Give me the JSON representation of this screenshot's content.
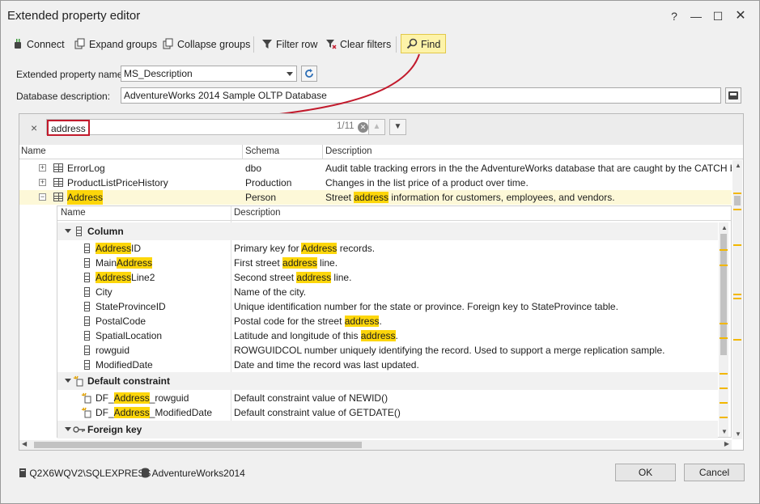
{
  "window": {
    "title": "Extended property editor",
    "help": "?",
    "minimize": "—",
    "maximize": "☐",
    "close": "✕"
  },
  "toolbar": {
    "connect": "Connect",
    "expand_groups": "Expand groups",
    "collapse_groups": "Collapse groups",
    "filter_row": "Filter row",
    "clear_filters": "Clear filters",
    "find": "Find"
  },
  "properties": {
    "name_label": "Extended property name:",
    "name_value": "MS_Description",
    "db_desc_label": "Database description:",
    "db_desc_value": "AdventureWorks 2014 Sample OLTP Database"
  },
  "findbar": {
    "close": "×",
    "query": "address",
    "count": "1/11",
    "clear": "✕",
    "prev": "▲",
    "next": "▼"
  },
  "grid": {
    "columns": [
      "Name",
      "Schema",
      "Description"
    ],
    "rows": [
      {
        "expander": "+",
        "name": "ErrorLog",
        "schema": "dbo",
        "desc": "Audit table tracking errors in the the AdventureWorks database that are caught by the CATCH block of a"
      },
      {
        "expander": "+",
        "name": "ProductListPriceHistory",
        "schema": "Production",
        "desc": "Changes in the list price of a product over time."
      },
      {
        "expander": "−",
        "name": "Address",
        "schema": "Person",
        "desc_pre": "Street ",
        "desc_hl": "address",
        "desc_post": " information for customers, employees, and vendors."
      }
    ]
  },
  "detail": {
    "columns": [
      "Name",
      "Description"
    ],
    "group_column": "Column",
    "column_rows": [
      {
        "n_pre": "",
        "n_hl": "Address",
        "n_post": "ID",
        "d_pre": "Primary key for ",
        "d_hl": "Address",
        "d_post": " records."
      },
      {
        "n_pre": "Main",
        "n_hl": "Address",
        "n_post": "",
        "d_pre": "First street ",
        "d_hl": "address",
        "d_post": " line."
      },
      {
        "n_pre": "",
        "n_hl": "Address",
        "n_post": "Line2",
        "d_pre": "Second street ",
        "d_hl": "address",
        "d_post": " line."
      },
      {
        "n_pre": "City",
        "n_hl": "",
        "n_post": "",
        "d_pre": "Name of the city.",
        "d_hl": "",
        "d_post": ""
      },
      {
        "n_pre": "StateProvinceID",
        "n_hl": "",
        "n_post": "",
        "d_pre": "Unique identification number for the state or province. Foreign key to StateProvince table.",
        "d_hl": "",
        "d_post": ""
      },
      {
        "n_pre": "PostalCode",
        "n_hl": "",
        "n_post": "",
        "d_pre": "Postal code for the street ",
        "d_hl": "address",
        "d_post": "."
      },
      {
        "n_pre": "SpatialLocation",
        "n_hl": "",
        "n_post": "",
        "d_pre": "Latitude and longitude of this ",
        "d_hl": "address",
        "d_post": "."
      },
      {
        "n_pre": "rowguid",
        "n_hl": "",
        "n_post": "",
        "d_pre": "ROWGUIDCOL number uniquely identifying the record. Used to support a merge replication sample.",
        "d_hl": "",
        "d_post": ""
      },
      {
        "n_pre": "ModifiedDate",
        "n_hl": "",
        "n_post": "",
        "d_pre": "Date and time the record was last updated.",
        "d_hl": "",
        "d_post": ""
      }
    ],
    "group_default": "Default constraint",
    "default_rows": [
      {
        "n_pre": "DF_",
        "n_hl": "Address",
        "n_post": "_rowguid",
        "d_pre": "Default constraint value of NEWID()",
        "d_hl": "",
        "d_post": ""
      },
      {
        "n_pre": "DF_",
        "n_hl": "Address",
        "n_post": "_ModifiedDate",
        "d_pre": "Default constraint value of GETDATE()",
        "d_hl": "",
        "d_post": ""
      }
    ],
    "group_fk": "Foreign key"
  },
  "footer": {
    "server": "Q2X6WQV2\\SQLEXPRESS",
    "database": "AdventureWorks2014",
    "ok": "OK",
    "cancel": "Cancel"
  },
  "colors": {
    "highlight": "#fdd60a",
    "find_bg": "#fdf3a9",
    "find_border": "#c21a2c"
  }
}
